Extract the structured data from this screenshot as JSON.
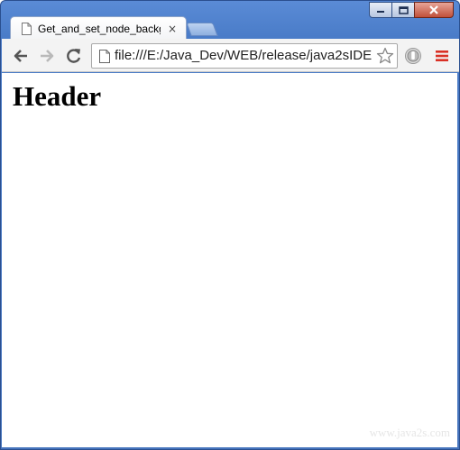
{
  "window": {
    "controls": {
      "minimize": "minimize-icon",
      "maximize": "maximize-icon",
      "close": "close-icon"
    }
  },
  "tab": {
    "title": "Get_and_set_node_backgr",
    "close_glyph": "×",
    "icon": "page-icon"
  },
  "toolbar": {
    "back_icon": "arrow-left-icon",
    "forward_icon": "arrow-right-icon",
    "reload_icon": "reload-icon",
    "url": "file:///E:/Java_Dev/WEB/release/java2sIDE",
    "star_icon": "star-icon",
    "extension_icon": "extension-icon",
    "menu_icon": "menu-icon"
  },
  "page": {
    "header": "Header",
    "watermark": "www.java2s.com"
  },
  "colors": {
    "frame": "#4a7cc8",
    "menu_accent": "#d93025"
  }
}
